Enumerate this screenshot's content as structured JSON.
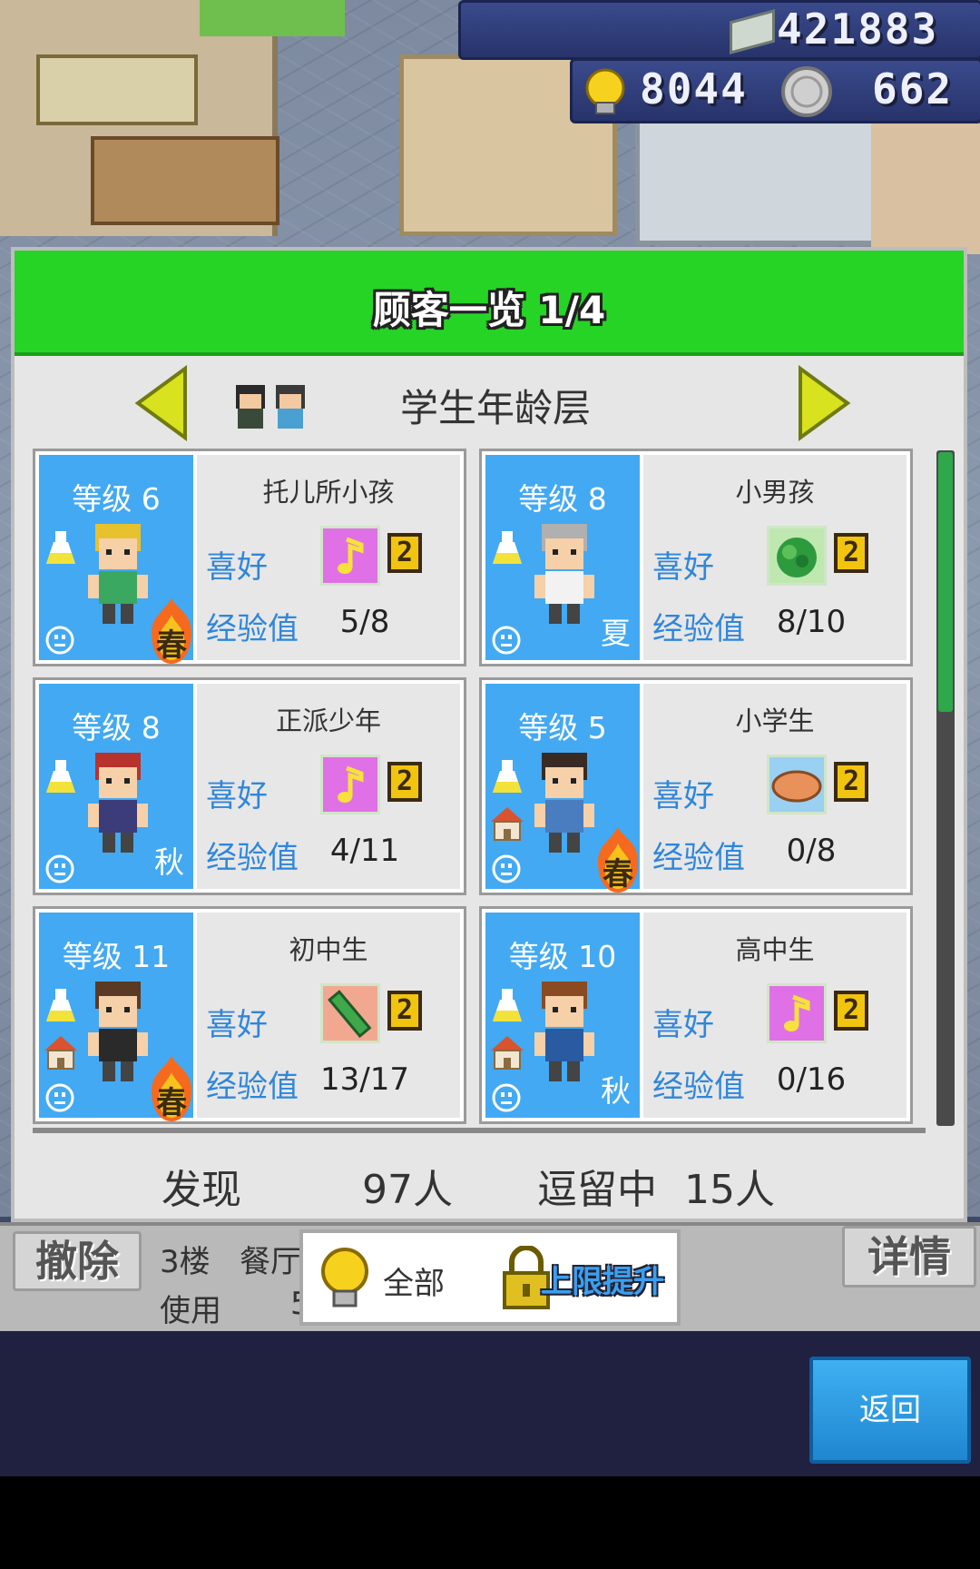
{
  "hud": {
    "money": "421883",
    "research_points": "8044",
    "medals": "662",
    "money_icon": "cash-icon",
    "research_icon": "lightbulb-icon",
    "medal_icon": "silver-coin-icon"
  },
  "panel": {
    "title": "顾客一览 1/4",
    "category": "学生年龄层",
    "prev_icon": "arrow-left-icon",
    "next_icon": "arrow-right-icon"
  },
  "labels": {
    "preference": "喜好",
    "experience": "经验值"
  },
  "customers": [
    {
      "level": "等级 6",
      "name": "托儿所小孩",
      "pref_icon": "music-note-icon",
      "pref_color": "#e070e6",
      "pref_level": "2",
      "exp": "5/8",
      "season": "",
      "season_badge": "春",
      "has_house": false,
      "char_color": "#e8c22e",
      "char_shirt": "#3aa860"
    },
    {
      "level": "等级 8",
      "name": "小男孩",
      "pref_icon": "vegetable-icon",
      "pref_color": "#2e9a3e",
      "pref_level": "2",
      "exp": "8/10",
      "season": "夏",
      "season_badge": "",
      "has_house": false,
      "char_color": "#b0b0b0",
      "char_shirt": "#f2f2f2"
    },
    {
      "level": "等级 8",
      "name": "正派少年",
      "pref_icon": "music-note-icon",
      "pref_color": "#e070e6",
      "pref_level": "2",
      "exp": "4/11",
      "season": "秋",
      "season_badge": "",
      "has_house": false,
      "char_color": "#b8322e",
      "char_shirt": "#3c3c7a"
    },
    {
      "level": "等级 5",
      "name": "小学生",
      "pref_icon": "bread-icon",
      "pref_color": "#e8915a",
      "pref_level": "2",
      "exp": "0/8",
      "season": "",
      "season_badge": "春",
      "has_house": true,
      "char_color": "#3a2a24",
      "char_shirt": "#4a7cc0"
    },
    {
      "level": "等级 11",
      "name": "初中生",
      "pref_icon": "pencil-icon",
      "pref_color": "#3ea84a",
      "pref_level": "2",
      "exp": "13/17",
      "season": "",
      "season_badge": "春",
      "has_house": true,
      "char_color": "#5a3a24",
      "char_shirt": "#2a2a2a"
    },
    {
      "level": "等级 10",
      "name": "高中生",
      "pref_icon": "music-note-icon",
      "pref_color": "#e070e6",
      "pref_level": "2",
      "exp": "0/16",
      "season": "秋",
      "season_badge": "",
      "has_house": true,
      "char_color": "#8a4a22",
      "char_shirt": "#2a5aa0"
    }
  ],
  "footer": {
    "found_label": "发现",
    "found_value": "97人",
    "staying_label": "逗留中",
    "staying_value": "15人"
  },
  "infobar": {
    "remove_button": "撤除",
    "floor_text": "3楼",
    "facility_text": "餐厅",
    "use_text": "使用",
    "use_value_partial": "5",
    "details_button": "详情"
  },
  "filter": {
    "label": "全部",
    "limit_up_label": "上限提升",
    "icon": "lightbulb-icon",
    "lock_icon": "padlock-icon"
  },
  "back_button": "返回",
  "scroll_position": 0.25
}
